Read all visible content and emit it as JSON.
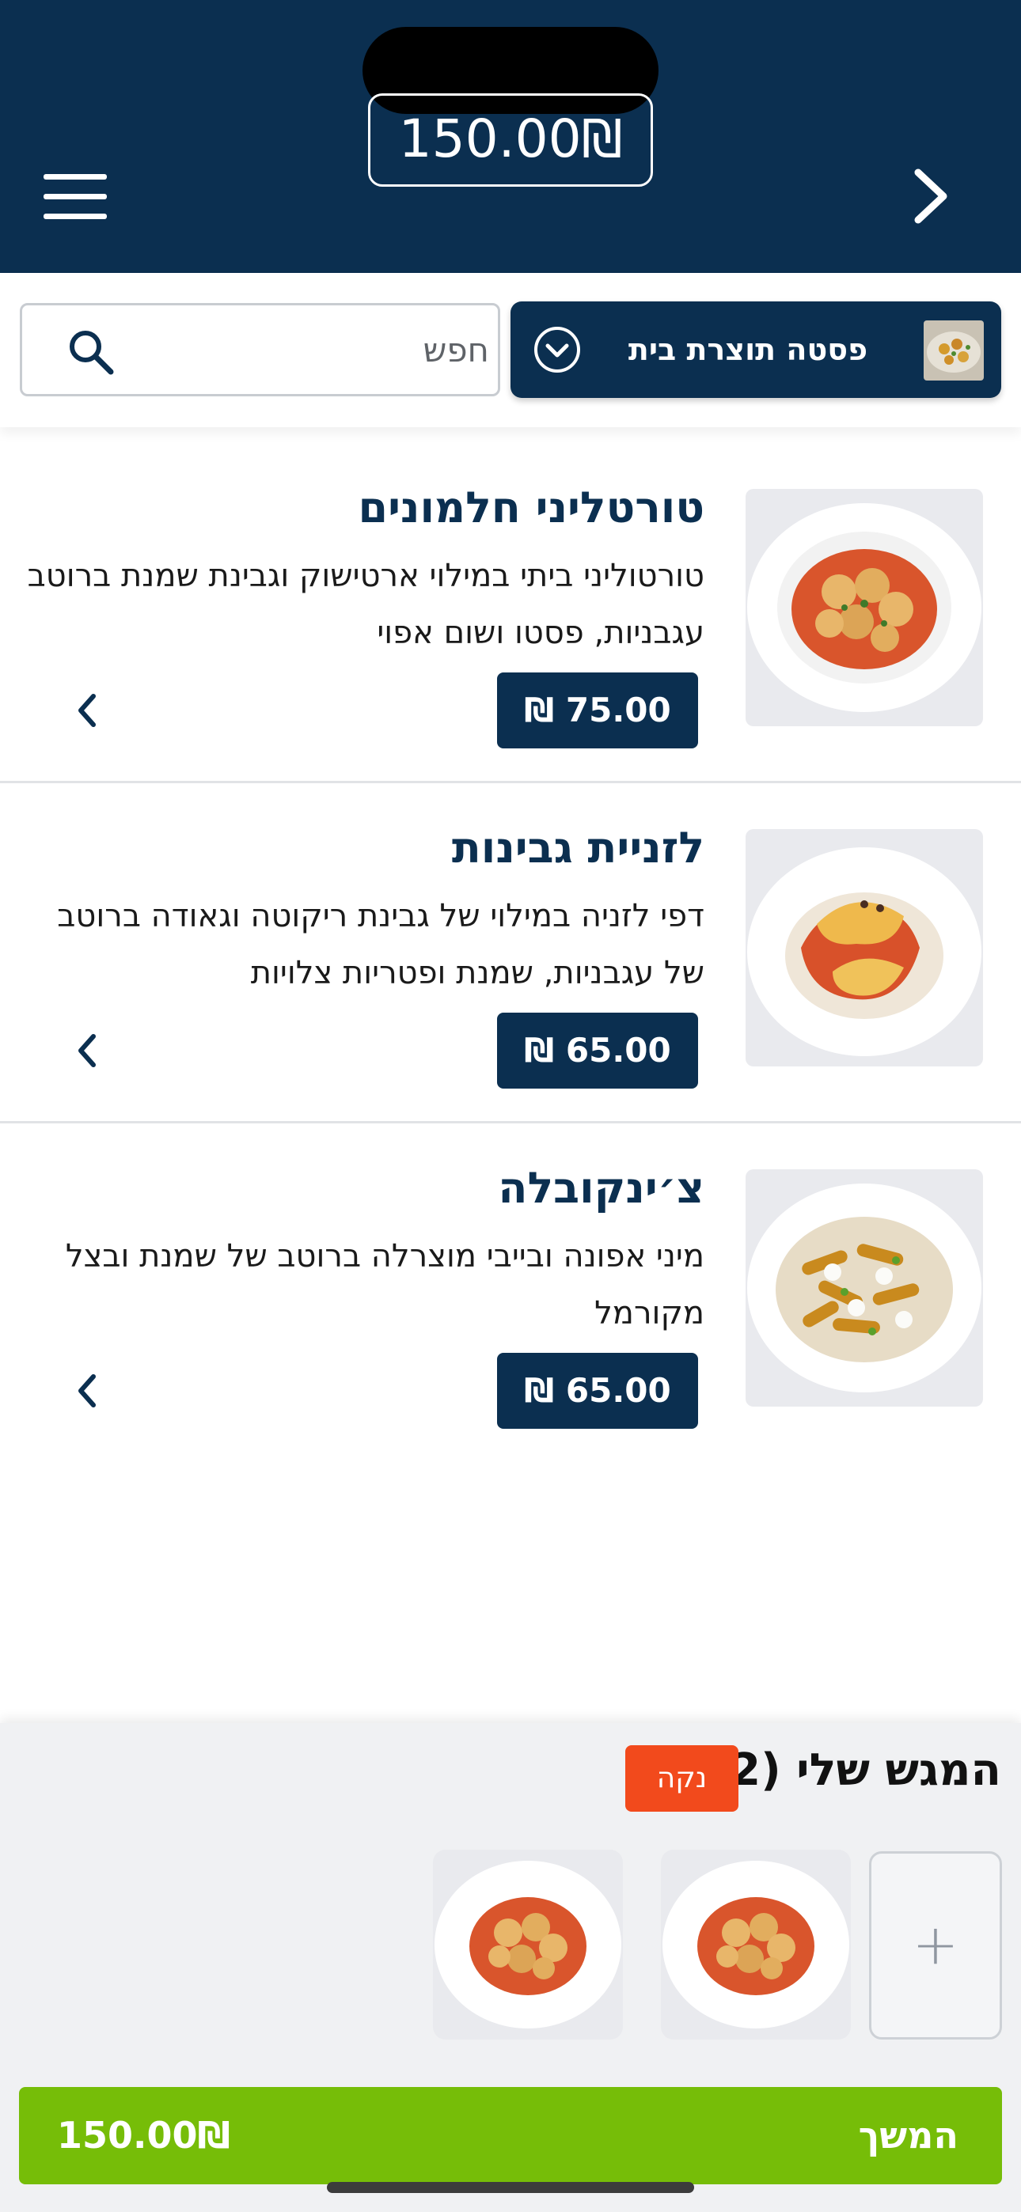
{
  "header": {
    "total": "150.00₪"
  },
  "filter": {
    "search_placeholder": "חפש",
    "category_label": "פסטה תוצרת בית"
  },
  "items": [
    {
      "title": "טורטליני חלמונים",
      "description": "טורטוליני ביתי במילוי ארטישוק וגבינת שמנת ברוטב עגבניות, פסטו ושום אפוי",
      "price": "₪ 75.00"
    },
    {
      "title": "לזניית גבינות",
      "description": "דפי לזניה במילוי של גבינת ריקוטה וגאודה ברוטב של עגבניות, שמנת ופטריות צלויות",
      "price": "₪ 65.00"
    },
    {
      "title": "צ׳ינקובלה",
      "description": "מיני אפונה ובייבי מוצרלה ברוטב של שמנת ובצל מקורמל",
      "price": "₪ 65.00"
    }
  ],
  "tray": {
    "title": "המגש שלי (2)",
    "clear_label": "נקה",
    "add_symbol": "+"
  },
  "footer": {
    "continue_label": "המשך",
    "total": "150.00₪"
  },
  "colors": {
    "primary": "#0b2f50",
    "accent_green": "#76bd08",
    "clear_orange": "#f24a1c"
  }
}
